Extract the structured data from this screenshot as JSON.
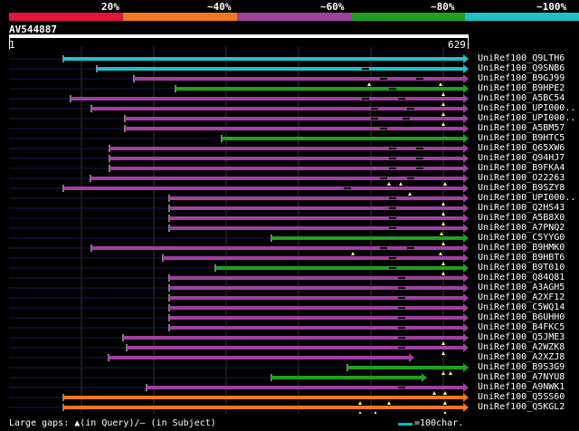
{
  "header": {
    "percent_labels": [
      "20%",
      "~40%",
      "~60%",
      "~80%",
      "~100%"
    ],
    "colors": [
      "#e0143c",
      "#f07820",
      "#a040a0",
      "#20a020",
      "#20c0c8"
    ],
    "query_name": "AV544887",
    "query_start": "1",
    "query_end": "629"
  },
  "hits": [
    {
      "label": "UniRef100_Q9LTH6",
      "color": "#20c0c8",
      "start": 70,
      "gaps": [],
      "tri": []
    },
    {
      "label": "UniRef100_Q9SNB6",
      "color": "#20c0c8",
      "start": 107,
      "gaps": [
        400
      ],
      "tri": []
    },
    {
      "label": "UniRef100_B9GJ99",
      "color": "#a040a0",
      "start": 148,
      "gaps": [
        420,
        460
      ],
      "tri": [
        408,
        487
      ]
    },
    {
      "label": "UniRef100_B9HPE2",
      "color": "#20a020",
      "start": 194,
      "gaps": [
        430
      ],
      "tri": [
        490
      ]
    },
    {
      "label": "UniRef100_A5BC54",
      "color": "#a040a0",
      "start": 78,
      "gaps": [
        400,
        440
      ],
      "tri": [
        490
      ]
    },
    {
      "label": "UniRef100_UPI000..",
      "color": "#a040a0",
      "start": 101,
      "gaps": [
        410,
        450
      ],
      "tri": [
        490
      ]
    },
    {
      "label": "UniRef100_UPI000..",
      "color": "#a040a0",
      "start": 138,
      "gaps": [
        410,
        445
      ],
      "tri": [
        490
      ]
    },
    {
      "label": "UniRef100_A5BM57",
      "color": "#a040a0",
      "start": 138,
      "gaps": [
        420
      ],
      "tri": []
    },
    {
      "label": "UniRef100_B9HTC5",
      "color": "#20a020",
      "start": 245,
      "gaps": [],
      "tri": []
    },
    {
      "label": "UniRef100_Q65XW6",
      "color": "#a040a0",
      "start": 121,
      "gaps": [
        430,
        460
      ],
      "tri": []
    },
    {
      "label": "UniRef100_Q94HJ7",
      "color": "#a040a0",
      "start": 121,
      "gaps": [
        430,
        460
      ],
      "tri": []
    },
    {
      "label": "UniRef100_B9FKA4",
      "color": "#a040a0",
      "start": 121,
      "gaps": [
        430,
        460
      ],
      "tri": []
    },
    {
      "label": "UniRef100_O22263",
      "color": "#a040a0",
      "start": 100,
      "gaps": [
        420,
        450
      ],
      "tri": [
        430,
        443,
        492
      ]
    },
    {
      "label": "UniRef100_B9SZY8",
      "color": "#a040a0",
      "start": 70,
      "gaps": [
        380
      ],
      "tri": [
        453
      ]
    },
    {
      "label": "UniRef100_UPI000..",
      "color": "#a040a0",
      "start": 187,
      "gaps": [
        430
      ],
      "tri": [
        490
      ]
    },
    {
      "label": "UniRef100_Q2HS43",
      "color": "#a040a0",
      "start": 187,
      "gaps": [
        430
      ],
      "tri": [
        490
      ]
    },
    {
      "label": "UniRef100_A5B8X0",
      "color": "#a040a0",
      "start": 187,
      "gaps": [
        430
      ],
      "tri": [
        490
      ]
    },
    {
      "label": "UniRef100_A7PNQ2",
      "color": "#a040a0",
      "start": 187,
      "gaps": [
        430
      ],
      "tri": [
        488
      ]
    },
    {
      "label": "UniRef100_C5YYG0",
      "color": "#20a020",
      "start": 300,
      "gaps": [],
      "tri": [
        490
      ]
    },
    {
      "label": "UniRef100_B9HMK0",
      "color": "#a040a0",
      "start": 101,
      "gaps": [
        420,
        450
      ],
      "tri": [
        390,
        487
      ]
    },
    {
      "label": "UniRef100_B9HBT6",
      "color": "#a040a0",
      "start": 180,
      "gaps": [
        430
      ],
      "tri": [
        490
      ]
    },
    {
      "label": "UniRef100_B9T010",
      "color": "#20a020",
      "start": 238,
      "gaps": [
        430
      ],
      "tri": [
        490
      ]
    },
    {
      "label": "UniRef100_Q84Q81",
      "color": "#a040a0",
      "start": 187,
      "gaps": [
        440
      ],
      "tri": []
    },
    {
      "label": "UniRef100_A3AGH5",
      "color": "#a040a0",
      "start": 187,
      "gaps": [
        440
      ],
      "tri": []
    },
    {
      "label": "UniRef100_A2XF12",
      "color": "#a040a0",
      "start": 187,
      "gaps": [
        440
      ],
      "tri": []
    },
    {
      "label": "UniRef100_C5WQ14",
      "color": "#a040a0",
      "start": 187,
      "gaps": [
        440
      ],
      "tri": []
    },
    {
      "label": "UniRef100_B6UHH0",
      "color": "#a040a0",
      "start": 187,
      "gaps": [
        440
      ],
      "tri": []
    },
    {
      "label": "UniRef100_B4FKC5",
      "color": "#a040a0",
      "start": 187,
      "gaps": [
        440
      ],
      "tri": []
    },
    {
      "label": "UniRef100_Q5JME3",
      "color": "#a040a0",
      "start": 136,
      "gaps": [
        440
      ],
      "tri": [
        490
      ]
    },
    {
      "label": "UniRef100_A2WZK8",
      "color": "#a040a0",
      "start": 140,
      "gaps": [
        440
      ],
      "tri": [
        490
      ]
    },
    {
      "label": "UniRef100_A2XZJ8",
      "color": "#a040a0",
      "start": 120,
      "gaps": [],
      "tri": [],
      "end": 452
    },
    {
      "label": "UniRef100_B9S3G9",
      "color": "#20a020",
      "start": 384,
      "gaps": [],
      "tri": [
        490,
        498
      ]
    },
    {
      "label": "UniRef100_A7NYU8",
      "color": "#20a020",
      "start": 300,
      "gaps": [],
      "tri": [],
      "end": 466
    },
    {
      "label": "UniRef100_A9NWK1",
      "color": "#a040a0",
      "start": 162,
      "gaps": [
        440
      ],
      "tri": [
        480,
        492
      ]
    },
    {
      "label": "UniRef100_Q5SS60",
      "color": "#f07820",
      "start": 70,
      "gaps": [],
      "tri": [
        398,
        430,
        492
      ]
    },
    {
      "label": "UniRef100_Q5KGL2",
      "color": "#f07820",
      "start": 70,
      "gaps": [],
      "tri": [
        398,
        415,
        492
      ]
    }
  ],
  "footer": {
    "legend": "Large gaps: ▲(in Query)/— (in Subject)",
    "scale": "=100char."
  }
}
